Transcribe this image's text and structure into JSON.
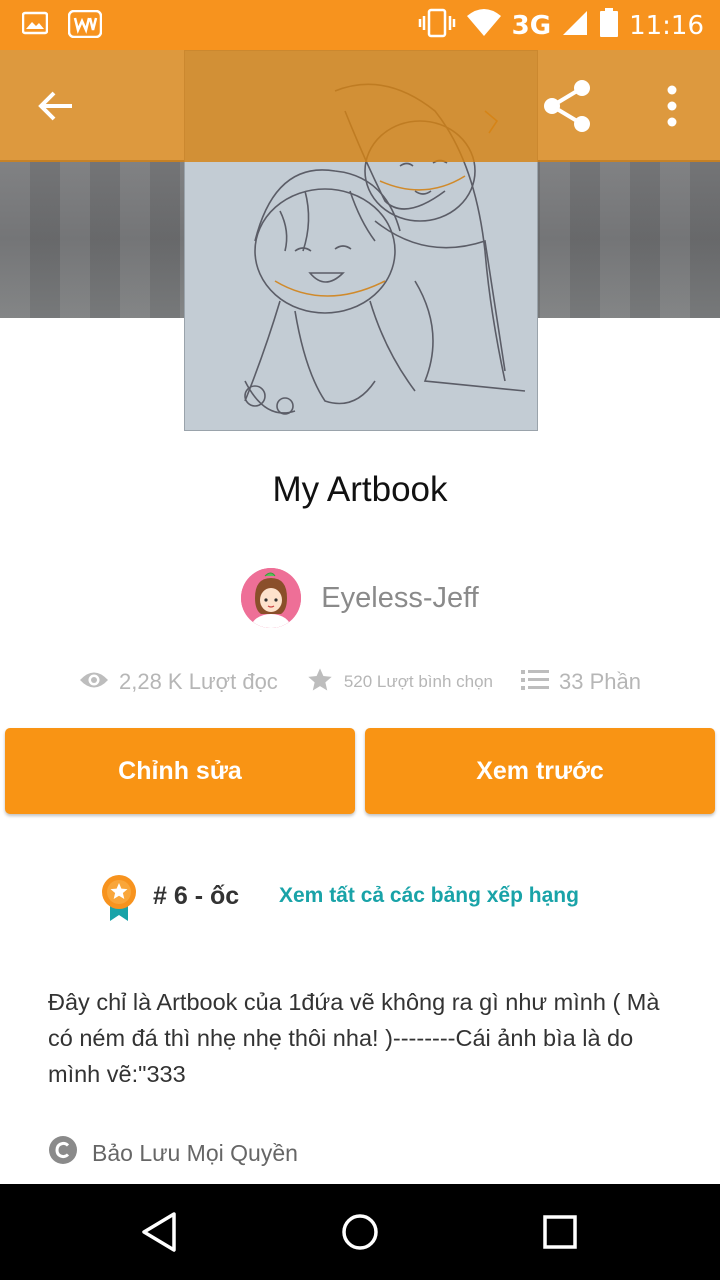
{
  "status_bar": {
    "network": "3G",
    "time": "11:16",
    "icons": [
      "image-icon",
      "wattpad-icon",
      "vibrate-icon",
      "wifi-icon",
      "signal-icon",
      "battery-icon"
    ]
  },
  "toolbar": {
    "icons": [
      "back-arrow-icon",
      "share-icon",
      "more-vert-icon"
    ]
  },
  "story": {
    "title": "My Artbook",
    "author": "Eyeless-Jeff",
    "reads": "2,28 K Lượt đọc",
    "votes": "520 Lượt bình chọn",
    "parts": "33 Phần",
    "description": "Đây chỉ là Artbook của 1đứa vẽ không ra gì như mình ( Mà có ném đá thì nhẹ nhẹ thôi nha! )--------Cái ảnh bìa là do mình vẽ:\"333",
    "copyright": "Bảo Lưu Mọi Quyền"
  },
  "buttons": {
    "edit": "Chỉnh sửa",
    "preview": "Xem trước"
  },
  "ranking": {
    "text": "# 6 - ốc",
    "link": "Xem tất cả các bảng xếp hạng"
  },
  "colors": {
    "accent": "#f7931e",
    "button": "#f99414",
    "link": "#19a3a8",
    "muted": "#b6b6b6"
  }
}
